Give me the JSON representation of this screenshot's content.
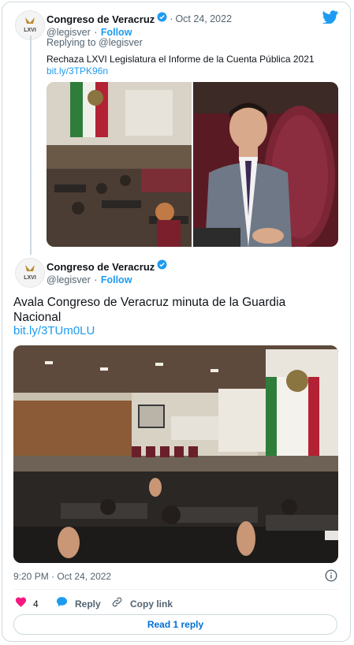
{
  "tweet1": {
    "display_name": "Congreso de Veracruz",
    "handle": "@legisver",
    "separator": "·",
    "follow_label": "Follow",
    "date": "Oct 24, 2022",
    "replying_prefix": "Replying to ",
    "replying_to": "@legisver",
    "text": "Rechaza LXVI Legislatura el Informe de la Cuenta Pública 2021",
    "link": "bit.ly/3TPK96n"
  },
  "tweet2": {
    "display_name": "Congreso de Veracruz",
    "handle": "@legisver",
    "separator": "·",
    "follow_label": "Follow",
    "text": "Avala Congreso de Veracruz minuta de la Guardia Nacional",
    "link": "bit.ly/3TUm0LU",
    "time": "9:20 PM",
    "date": "Oct 24, 2022"
  },
  "avatar_text": "LXVI",
  "actions": {
    "likes": "4",
    "reply_label": "Reply",
    "copy_link_label": "Copy link"
  },
  "read_reply_label": "Read 1 reply",
  "colors": {
    "accent": "#1d9bf0",
    "heart": "#f91880",
    "verified": "#1d9bf0",
    "border": "#cfd9de"
  },
  "icons": [
    "twitter-bird-icon",
    "verified-badge-icon",
    "info-icon",
    "heart-icon",
    "reply-bubble-icon",
    "link-icon"
  ]
}
